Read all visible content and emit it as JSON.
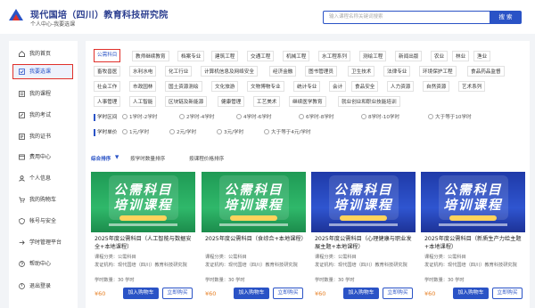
{
  "header": {
    "title": "现代国培（四川）教育科技研究院",
    "subtitle": "个人中心-我要选课",
    "search_placeholder": "输入课程名称关键词搜索",
    "search_button": "搜 索"
  },
  "sidebar": {
    "items": [
      {
        "label": "我的首页",
        "icon": "home-icon"
      },
      {
        "label": "我要选课",
        "icon": "select-course-icon",
        "active": true
      },
      {
        "label": "我的课程",
        "icon": "course-icon"
      },
      {
        "label": "我的考试",
        "icon": "exam-icon"
      },
      {
        "label": "我的证书",
        "icon": "certificate-icon"
      },
      {
        "label": "费用中心",
        "icon": "fee-icon"
      },
      {
        "label": "个人信息",
        "icon": "user-icon"
      },
      {
        "label": "我的购物车",
        "icon": "cart-icon"
      },
      {
        "label": "帐号与安全",
        "icon": "shield-icon"
      },
      {
        "label": "学时管理平台",
        "icon": "arrow-icon"
      },
      {
        "label": "帮助中心",
        "icon": "help-icon"
      },
      {
        "label": "退出登录",
        "icon": "logout-icon"
      }
    ]
  },
  "categories": [
    [
      "公需科目",
      "教师继续教育",
      "档案专业",
      "建筑工程",
      "交通工程",
      "机械工程",
      "水工程系列",
      "测绘工程",
      "新闻出版",
      "农业",
      "林业",
      "渔业"
    ],
    [
      "畜牧兽医",
      "水利水电",
      "化工行业",
      "计算机信息及网络安全",
      "经济金融",
      "图书管理员",
      "卫生技术",
      "法律专业",
      "环境保护工程",
      "食品药品监督"
    ],
    [
      "社会工作",
      "市政园林",
      "国土资源测绘",
      "文化旅游",
      "文物博物专业",
      "统计专业",
      "会计",
      "食品安全",
      "人力资源",
      "自然资源",
      "艺术系列"
    ],
    [
      "人事管理",
      "人工智能",
      "区块链及新能源",
      "健康管理",
      "工艺美术",
      "继续医学教育",
      "就业创业和职业技能培训"
    ]
  ],
  "filters": {
    "hours": {
      "title": "学时区间",
      "options": [
        "1学时-2学时",
        "2学时-4学时",
        "4学时-6学时",
        "6学时-8学时",
        "8学时-10学时",
        "大于等于10学时"
      ]
    },
    "price": {
      "title": "学时单价",
      "options": [
        "1元/学时",
        "2元/学时",
        "3元/学时",
        "大于等于4元/学时"
      ]
    }
  },
  "sort": {
    "default": "综合排序",
    "time": "按学时数量排序",
    "price": "按课程价格排序"
  },
  "cards": [
    {
      "banner_line1": "公需科目",
      "banner_line2": "培训课程",
      "theme": "green",
      "title": "2025年度公需科目（人工智能与数据安全+本地课程）",
      "type": "课程分类：公需科目",
      "org": "发证机构：现代国培（四川）教育科技研究院",
      "hours": "学时数量：30 学时",
      "price": "¥60",
      "cart": "加入购物车",
      "buy": "立即购买"
    },
    {
      "banner_line1": "公需科目",
      "banner_line2": "培训课程",
      "theme": "green",
      "title": "2025年度公需科目（食综合+本地课程）",
      "type": "课程分类：公需科目",
      "org": "发证机构：现代国培（四川）教育科技研究院",
      "hours": "学时数量：30 学时",
      "price": "¥60",
      "cart": "加入购物车",
      "buy": "立即购买"
    },
    {
      "banner_line1": "公需科目",
      "banner_line2": "培训课程",
      "theme": "blue",
      "title": "2025年度公需科目（心理健康与职业发展主题+本地课程）",
      "type": "课程分类：公需科目",
      "org": "发证机构：现代国培（四川）教育科技研究院",
      "hours": "学时数量：30 学时",
      "price": "¥60",
      "cart": "加入购物车",
      "buy": "立即购买"
    },
    {
      "banner_line1": "公需科目",
      "banner_line2": "培训课程",
      "theme": "blue",
      "title": "2025年度公需科目（新质生产力给主题+本地课程）",
      "type": "课程分类：公需科目",
      "org": "发证机构：现代国培（四川）教育科技研究院",
      "hours": "学时数量：30 学时",
      "price": "¥60",
      "cart": "加入购物车",
      "buy": "立即购买"
    }
  ],
  "colors": {
    "brand": "#2a53c6",
    "highlight_border": "#e0302a",
    "price": "#e67e22"
  }
}
